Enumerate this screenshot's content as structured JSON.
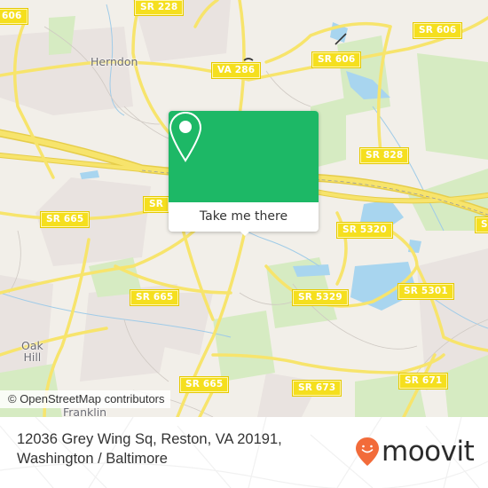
{
  "map": {
    "colors": {
      "land": "#f2efe9",
      "residential": "#e8e2df",
      "park": "#d8edc4",
      "water": "#a7d4ee",
      "road": "#f7e36a",
      "road_casing": "#e9cf4a",
      "minor_road": "#c8c2bc",
      "shield_bg": "#f5df1e"
    },
    "road_labels": [
      {
        "id": "sr228",
        "text": "SR 228"
      },
      {
        "id": "sr606-left",
        "text": "606"
      },
      {
        "id": "va286",
        "text": "VA 286"
      },
      {
        "id": "sr606-mid",
        "text": "SR 606"
      },
      {
        "id": "sr606-right",
        "text": "SR 606"
      },
      {
        "id": "sr828",
        "text": "SR 828"
      },
      {
        "id": "sr-partial-center",
        "text": "SR"
      },
      {
        "id": "sr665-left",
        "text": "SR 665"
      },
      {
        "id": "sr5320",
        "text": "SR 5320"
      },
      {
        "id": "sr-partial-right",
        "text": "SR"
      },
      {
        "id": "sr665-mid",
        "text": "SR 665"
      },
      {
        "id": "sr5329",
        "text": "SR 5329"
      },
      {
        "id": "sr5301",
        "text": "SR 5301"
      },
      {
        "id": "sr665-bottom",
        "text": "SR 665"
      },
      {
        "id": "sr673",
        "text": "SR 673"
      },
      {
        "id": "sr671",
        "text": "SR 671"
      }
    ],
    "place_labels": [
      {
        "id": "herndon",
        "text": "Herndon"
      },
      {
        "id": "oak-hill",
        "text": "Oak\nHill"
      },
      {
        "id": "franklin",
        "text": "Franklin"
      }
    ],
    "attribution": "© OpenStreetMap contributors"
  },
  "popup": {
    "icon": "map-pin-icon",
    "button_label": "Take me there",
    "accent_color": "#1db866"
  },
  "footer": {
    "address": "12036 Grey Wing Sq, Reston, VA 20191, Washington / Baltimore",
    "logo_text": "moovit",
    "logo_color": "#f26b3a"
  }
}
